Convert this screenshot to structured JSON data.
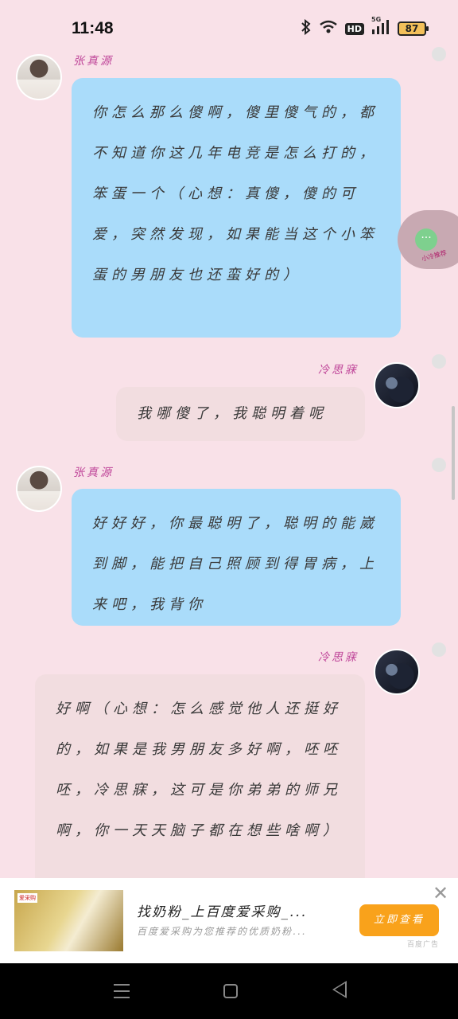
{
  "status_bar": {
    "time": "11:48",
    "battery": "87",
    "network_badge": "HD",
    "signal_label": "5G"
  },
  "messages": [
    {
      "sender": "张真源",
      "text": "你怎么那么傻啊，傻里傻气的，都不知道你这几年电竞是怎么打的，笨蛋一个（心想：真傻，傻的可爱，突然发现，如果能当这个小笨蛋的男朋友也还蛮好的）"
    },
    {
      "sender": "冷思寐",
      "text": "我哪傻了，我聪明着呢"
    },
    {
      "sender": "张真源",
      "text": "好好好，你最聪明了，聪明的能崴到脚，能把自己照顾到得胃病，上来吧，我背你"
    },
    {
      "sender": "冷思寐",
      "text": "好啊（心想：怎么感觉他人还挺好的，如果是我男朋友多好啊，呸呸呸，冷思寐，这可是你弟弟的师兄啊，你一天天脑子都在想些啥啊）"
    }
  ],
  "floating_button": {
    "label": "小冷推荐"
  },
  "ad": {
    "title": "找奶粉_上百度爱采购_...",
    "desc": "百度爱采购为您推荐的优质奶粉...",
    "button": "立即查看",
    "source": "百度广告",
    "logo": "爱采购"
  },
  "icons": {
    "bluetooth": "bluetooth-icon",
    "wifi": "wifi-icon",
    "signal": "signal-icon",
    "battery": "battery-icon",
    "close": "close-icon",
    "menu": "menu-icon",
    "home": "home-icon",
    "back": "back-icon"
  }
}
